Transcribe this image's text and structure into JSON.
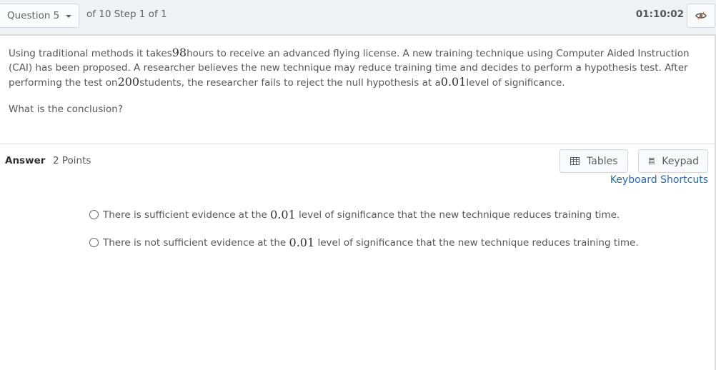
{
  "topbar": {
    "question_select": "Question 5",
    "progress": "of 10 Step 1 of 1",
    "timer": "01:10:02",
    "hide_timer_icon": "eye-slash-icon"
  },
  "question": {
    "parts": [
      "Using traditional methods it takes ",
      "98",
      " hours to receive an advanced flying license. A new training technique using Computer Aided Instruction (CAI) has been proposed. A researcher believes the new technique may reduce training time and decides to perform a hypothesis test. After performing the test on ",
      "200",
      " students, the researcher fails to reject the null hypothesis at a ",
      "0.01",
      " level of significance."
    ],
    "prompt": "What is the conclusion?"
  },
  "answer": {
    "label": "Answer",
    "points": "2 Points",
    "tables_button": "Tables",
    "keypad_button": "Keypad",
    "keyboard_shortcuts": "Keyboard Shortcuts",
    "options": [
      {
        "pre": "There is sufficient evidence at the ",
        "num": "0.01",
        "post": " level of significance that the new technique reduces training time.",
        "selected": false
      },
      {
        "pre": "There is not sufficient evidence at the ",
        "num": "0.01",
        "post": " level of significance that the new technique reduces training time.",
        "selected": false
      }
    ]
  }
}
